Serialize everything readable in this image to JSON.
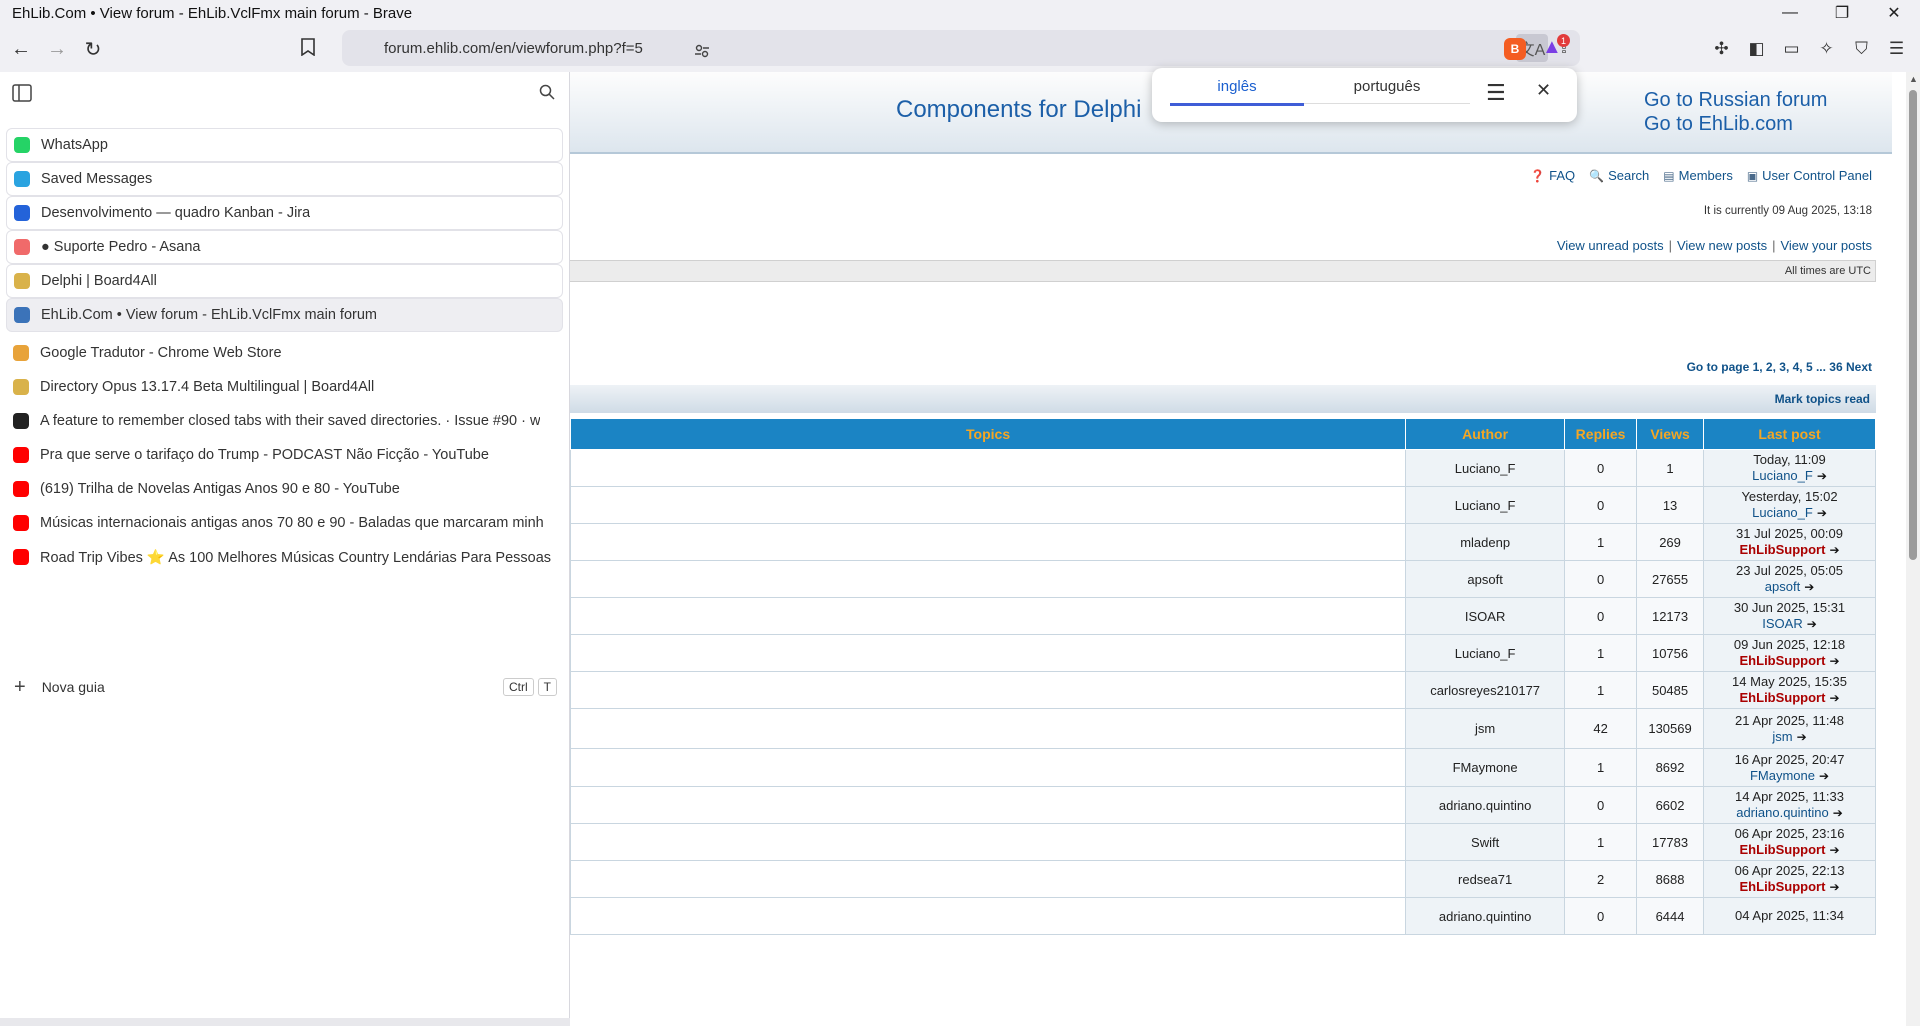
{
  "window": {
    "title": "EhLib.Com • View forum - EhLib.VclFmx main forum - Brave",
    "minimize": "—",
    "restore": "❐",
    "close": "✕"
  },
  "toolbar": {
    "back": "←",
    "forward": "→",
    "reload": "↻",
    "bookmark": "🔖",
    "url": "forum.ehlib.com/en/viewforum.php?f=5",
    "rewards_badge": "1"
  },
  "sidebar": {
    "tabs": [
      {
        "label": "WhatsApp",
        "fav_color": "#25d366"
      },
      {
        "label": "Saved Messages",
        "fav_color": "#2aa3e0"
      },
      {
        "label": "Desenvolvimento — quadro Kanban - Jira",
        "fav_color": "#2463d9"
      },
      {
        "label": "● Suporte Pedro - Asana",
        "fav_color": "#f06a6a"
      },
      {
        "label": "Delphi | Board4All",
        "fav_color": "#d9b24a"
      },
      {
        "label": "EhLib.Com • View forum - EhLib.VclFmx main forum",
        "fav_color": "#3b73b9"
      },
      {
        "label": "Google Tradutor - Chrome Web Store",
        "fav_color": "#e8a33a"
      },
      {
        "label": "Directory Opus 13.17.4 Beta Multilingual | Board4All",
        "fav_color": "#d9b24a"
      },
      {
        "label": "A feature to remember closed tabs with their saved directories. · Issue #90 · w",
        "fav_color": "#222222"
      },
      {
        "label": "Pra que serve o tarifaço do Trump - PODCAST Não Ficção - YouTube",
        "fav_color": "#ff0000"
      },
      {
        "label": "(619) Trilha de Novelas Antigas Anos 90 e 80 - YouTube",
        "fav_color": "#ff0000"
      },
      {
        "label": "Músicas internacionais antigas anos 70 80 e 90 - Baladas que marcaram minh",
        "fav_color": "#ff0000"
      },
      {
        "label": "Road Trip Vibes ⭐ As 100 Melhores Músicas Country Lendárias Para Pessoas",
        "fav_color": "#ff0000"
      }
    ],
    "new_tab": {
      "label": "Nova guia",
      "key1": "Ctrl",
      "key2": "T"
    }
  },
  "translate": {
    "lang_source": "inglês",
    "lang_target": "português",
    "menu": "☰",
    "close": "✕"
  },
  "forum": {
    "title": "Components for Delphi",
    "link_russian": "Go to Russian forum",
    "link_ehlib": "Go to EhLib.com",
    "nav": {
      "faq": "FAQ",
      "search": "Search",
      "members": "Members",
      "ucp": "User Control Panel"
    },
    "current_time": "It is currently 09 Aug 2025, 13:18",
    "unread": "View unread posts",
    "new": "View new posts",
    "yours": "View your posts",
    "sep": "|",
    "utc": "All times are UTC",
    "pagination": "Go to page 1, 2, 3, 4, 5 ... 36  Next",
    "mark_read": "Mark topics read",
    "headers": {
      "topics": "Topics",
      "author": "Author",
      "replies": "Replies",
      "views": "Views",
      "last_post": "Last post"
    },
    "rows": [
      {
        "author": "Luciano_F",
        "replies": "0",
        "views": "1",
        "date": "Today, 11:09",
        "user": "Luciano_F",
        "support": false
      },
      {
        "author": "Luciano_F",
        "replies": "0",
        "views": "13",
        "date": "Yesterday, 15:02",
        "user": "Luciano_F",
        "support": false
      },
      {
        "author": "mladenp",
        "replies": "1",
        "views": "269",
        "date": "31 Jul 2025, 00:09",
        "user": "EhLibSupport",
        "support": true
      },
      {
        "author": "apsoft",
        "replies": "0",
        "views": "27655",
        "date": "23 Jul 2025, 05:05",
        "user": "apsoft",
        "support": false
      },
      {
        "author": "ISOAR",
        "replies": "0",
        "views": "12173",
        "date": "30 Jun 2025, 15:31",
        "user": "ISOAR",
        "support": false
      },
      {
        "author": "Luciano_F",
        "replies": "1",
        "views": "10756",
        "date": "09 Jun 2025, 12:18",
        "user": "EhLibSupport",
        "support": true
      },
      {
        "author": "carlosreyes210177",
        "replies": "1",
        "views": "50485",
        "date": "14 May 2025, 15:35",
        "user": "EhLibSupport",
        "support": true
      },
      {
        "author": "jsm",
        "replies": "42",
        "views": "130569",
        "date": "21 Apr 2025, 11:48",
        "user": "jsm",
        "support": false
      },
      {
        "author": "FMaymone",
        "replies": "1",
        "views": "8692",
        "date": "16 Apr 2025, 20:47",
        "user": "FMaymone",
        "support": false
      },
      {
        "author": "adriano.quintino",
        "replies": "0",
        "views": "6602",
        "date": "14 Apr 2025, 11:33",
        "user": "adriano.quintino",
        "support": false
      },
      {
        "author": "Swift",
        "replies": "1",
        "views": "17783",
        "date": "06 Apr 2025, 23:16",
        "user": "EhLibSupport",
        "support": true
      },
      {
        "author": "redsea71",
        "replies": "2",
        "views": "8688",
        "date": "06 Apr 2025, 22:13",
        "user": "EhLibSupport",
        "support": true
      },
      {
        "author": "adriano.quintino",
        "replies": "0",
        "views": "6444",
        "date": "04 Apr 2025, 11:34",
        "user": "",
        "support": false
      }
    ]
  }
}
